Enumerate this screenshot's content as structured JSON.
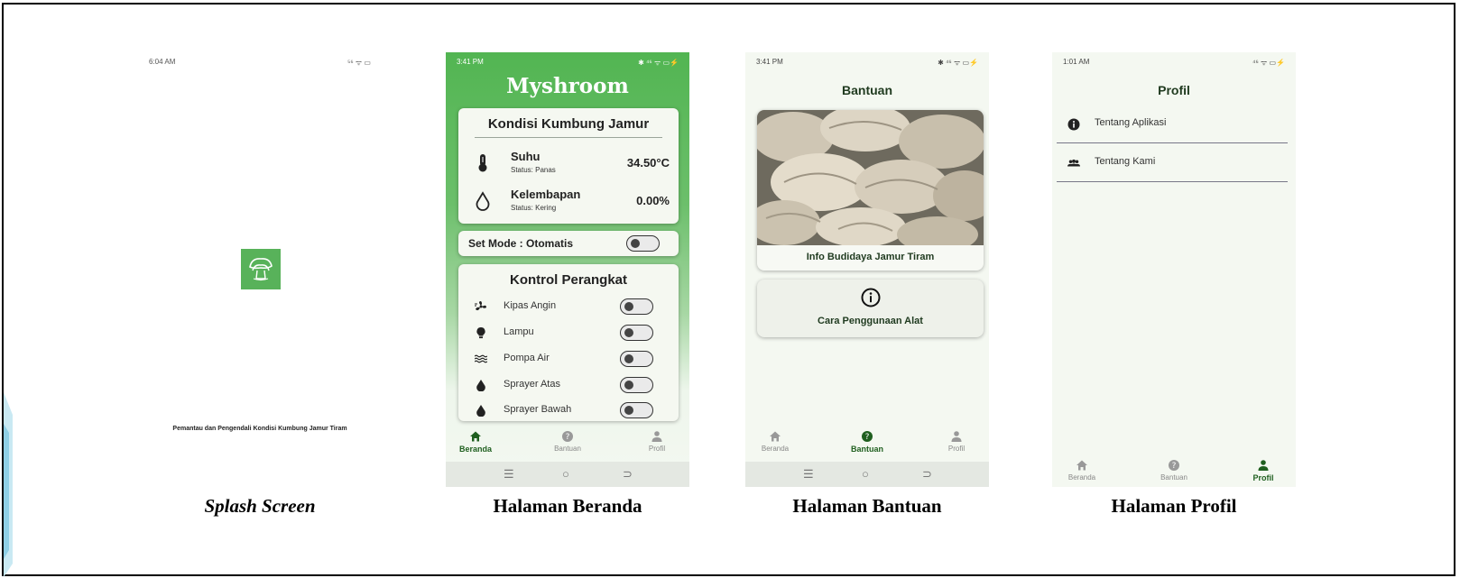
{
  "splash": {
    "status_time": "6:04 AM",
    "status_icons": "⁵⁶ ᯤ ▭",
    "tagline": "Pemantau dan Pengendali Kondisi Kumbung Jamur Tiram",
    "caption": "Splash Screen"
  },
  "beranda": {
    "status_time": "3:41 PM",
    "status_icons": "✱ ⁴⁶ ᯤ ▭⚡",
    "app_title": "Myshroom",
    "condition_card_title": "Kondisi Kumbung Jamur",
    "sensors": [
      {
        "name": "Suhu",
        "status": "Status: Panas",
        "value": "34.50°C",
        "icon": "thermometer-icon"
      },
      {
        "name": "Kelembapan",
        "status": "Status: Kering",
        "value": "0.00%",
        "icon": "water-drop-icon"
      }
    ],
    "set_mode_label": "Set Mode : Otomatis",
    "set_mode_on": false,
    "control_card_title": "Kontrol Perangkat",
    "devices": [
      {
        "name": "Kipas Angin",
        "icon": "fan-icon",
        "on": false
      },
      {
        "name": "Lampu",
        "icon": "lightbulb-icon",
        "on": false
      },
      {
        "name": "Pompa Air",
        "icon": "waves-icon",
        "on": false
      },
      {
        "name": "Sprayer Atas",
        "icon": "drop-icon",
        "on": false
      },
      {
        "name": "Sprayer Bawah",
        "icon": "drop-icon",
        "on": false
      }
    ],
    "caption": "Halaman Beranda"
  },
  "bantuan": {
    "status_time": "3:41 PM",
    "status_icons": "✱ ⁴⁶ ᯤ ▭⚡",
    "page_title": "Bantuan",
    "info_card_label": "Info Budidaya Jamur Tiram",
    "help_card_label": "Cara Penggunaan Alat",
    "caption": "Halaman Bantuan"
  },
  "profil": {
    "status_time": "1:01 AM",
    "status_icons": "⁴⁶ ᯤ ▭⚡",
    "page_title": "Profil",
    "items": [
      {
        "label": "Tentang Aplikasi",
        "icon": "info-icon"
      },
      {
        "label": "Tentang Kami",
        "icon": "group-icon"
      }
    ],
    "caption": "Halaman Profil"
  },
  "bottom_nav": {
    "home_label": "Beranda",
    "help_label": "Bantuan",
    "profile_label": "Profil"
  },
  "system_nav": {
    "menu": "☰",
    "home": "○",
    "back": "⊃"
  },
  "colors": {
    "primary_green": "#52b552",
    "dark_green_text": "#1f3a1f",
    "page_background": "#f4f8f1"
  }
}
